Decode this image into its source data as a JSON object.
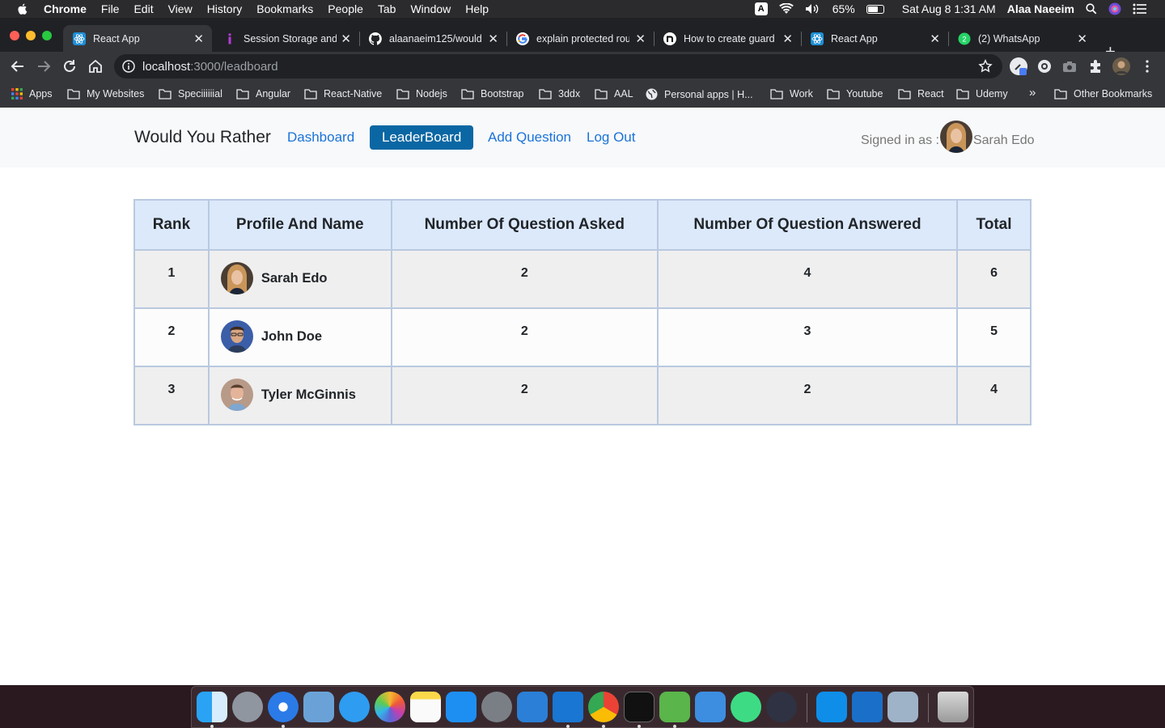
{
  "menubar": {
    "app": "Chrome",
    "items": [
      "File",
      "Edit",
      "View",
      "History",
      "Bookmarks",
      "People",
      "Tab",
      "Window",
      "Help"
    ],
    "ime": "A",
    "battery": "65%",
    "datetime": "Sat Aug 8  1:31 AM",
    "user": "Alaa Naeeim"
  },
  "tabs": [
    {
      "title": "React App",
      "icon": "react-icon"
    },
    {
      "title": "Session Storage and",
      "icon": "info-icon"
    },
    {
      "title": "alaanaeim125/would",
      "icon": "github-icon"
    },
    {
      "title": "explain protected rou",
      "icon": "google-icon"
    },
    {
      "title": "How to create guard",
      "icon": "n-icon"
    },
    {
      "title": "React App",
      "icon": "react-icon"
    },
    {
      "title": "(2) WhatsApp",
      "icon": "whatsapp-icon"
    }
  ],
  "toolbar": {
    "url_host": "localhost",
    "url_path": ":3000/leadboard"
  },
  "bookmarks": {
    "items": [
      "Apps",
      "My Websites",
      "Speciiiiiial",
      "Angular",
      "React-Native",
      "Nodejs",
      "Bootstrap",
      "3ddx",
      "AAL",
      "Personal apps | H...",
      "Work",
      "Youtube",
      "React",
      "Udemy"
    ],
    "overflow": "»",
    "other": "Other Bookmarks"
  },
  "navbar": {
    "brand": "Would You Rather",
    "links": [
      "Dashboard",
      "LeaderBoard",
      "Add Question",
      "Log Out"
    ],
    "active": "LeaderBoard",
    "signed_in_label": "Signed in as :",
    "user_name": "Sarah Edo"
  },
  "leaderboard": {
    "headers": [
      "Rank",
      "Profile And Name",
      "Number Of Question Asked",
      "Number Of Question Answered",
      "Total"
    ],
    "rows": [
      {
        "rank": "1",
        "name": "Sarah Edo",
        "asked": "2",
        "answered": "4",
        "total": "6"
      },
      {
        "rank": "2",
        "name": "John Doe",
        "asked": "2",
        "answered": "3",
        "total": "5"
      },
      {
        "rank": "3",
        "name": "Tyler McGinnis",
        "asked": "2",
        "answered": "2",
        "total": "4"
      }
    ]
  },
  "colors": {
    "accent": "#0a67a3",
    "link": "#1a73d9",
    "header_bg": "#dce9fb",
    "border": "#b9c9df"
  }
}
